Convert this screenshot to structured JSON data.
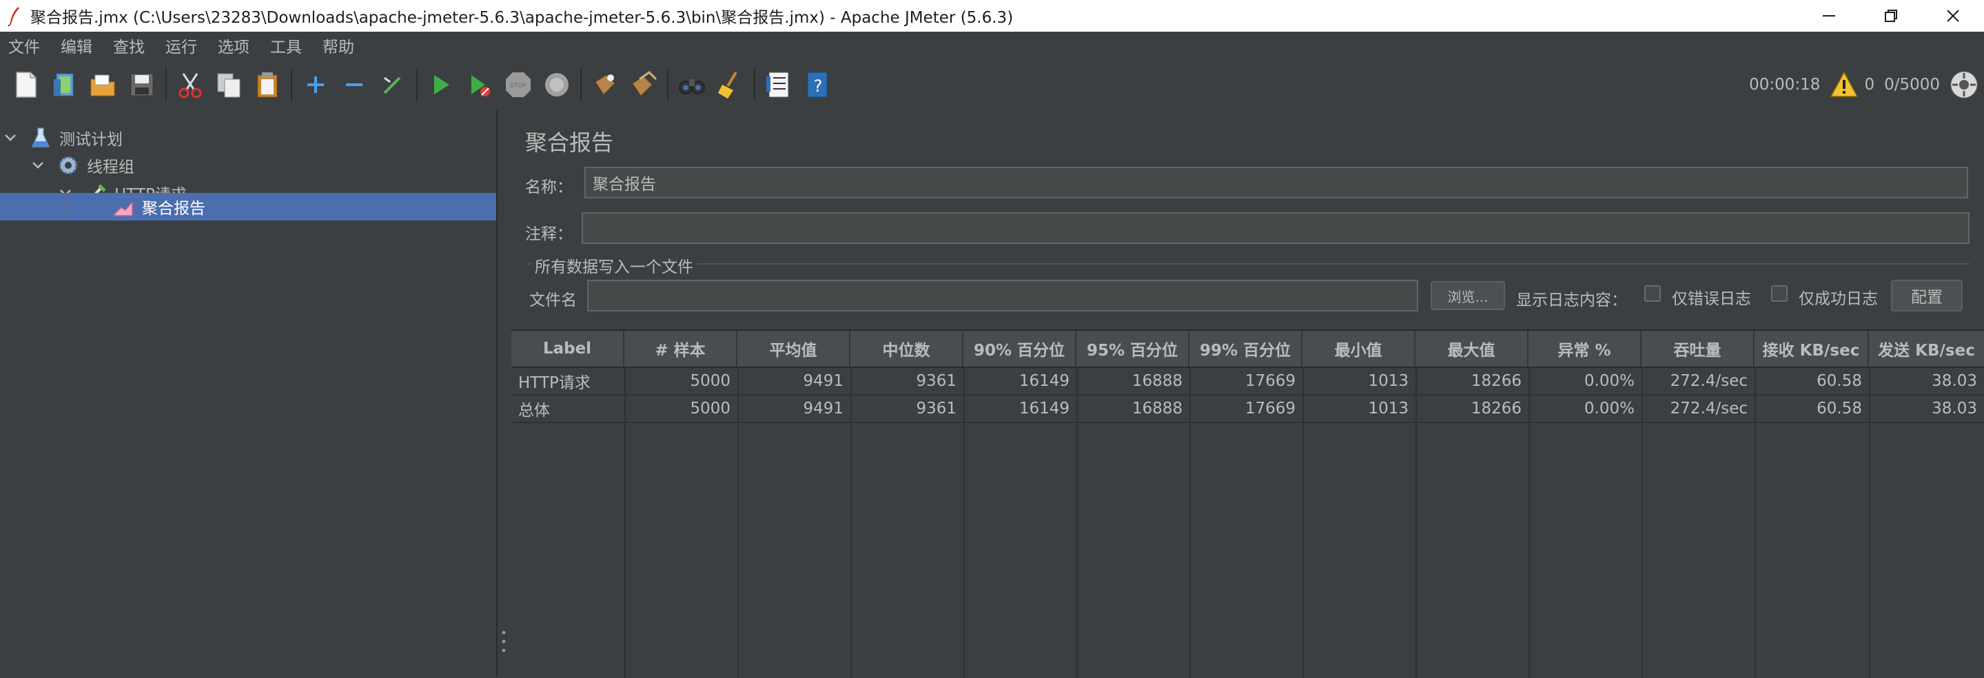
{
  "window": {
    "title": "聚合报告.jmx (C:\\Users\\23283\\Downloads\\apache-jmeter-5.6.3\\apache-jmeter-5.6.3\\bin\\聚合报告.jmx) - Apache JMeter (5.6.3)"
  },
  "menu": [
    "文件",
    "编辑",
    "查找",
    "运行",
    "选项",
    "工具",
    "帮助"
  ],
  "status": {
    "elapsed": "00:00:18",
    "errors": "0",
    "threads": "0/5000"
  },
  "tree": {
    "items": [
      {
        "label": "测试计划"
      },
      {
        "label": "线程组"
      },
      {
        "label": "HTTP请求"
      },
      {
        "label": "聚合报告"
      }
    ]
  },
  "panel": {
    "title": "聚合报告",
    "name_label": "名称：",
    "name_value": "聚合报告",
    "comment_label": "注释：",
    "comment_value": "",
    "file_group_title": "所有数据写入一个文件",
    "filename_label": "文件名",
    "filename_value": "",
    "browse_label": "浏览...",
    "log_display_label": "显示日志内容：",
    "errors_only_label": "仅错误日志",
    "success_only_label": "仅成功日志",
    "config_label": "配置"
  },
  "table": {
    "headers": [
      "Label",
      "# 样本",
      "平均值",
      "中位数",
      "90% 百分位",
      "95% 百分位",
      "99% 百分位",
      "最小值",
      "最大值",
      "异常 %",
      "吞吐量",
      "接收 KB/sec",
      "发送 KB/sec"
    ],
    "rows": [
      [
        "HTTP请求",
        "5000",
        "9491",
        "9361",
        "16149",
        "16888",
        "17669",
        "1013",
        "18266",
        "0.00%",
        "272.4/sec",
        "60.58",
        "38.03"
      ],
      [
        "总体",
        "5000",
        "9491",
        "9361",
        "16149",
        "16888",
        "17669",
        "1013",
        "18266",
        "0.00%",
        "272.4/sec",
        "60.58",
        "38.03"
      ]
    ]
  },
  "colors": {
    "background": "#3c3f41",
    "selection": "#4b6eaf",
    "text": "#bbbbbb"
  }
}
